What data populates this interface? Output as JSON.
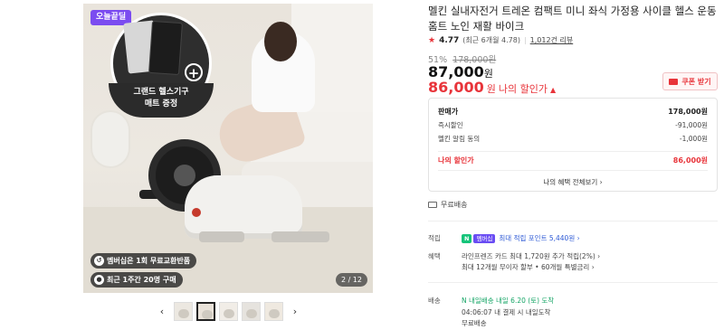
{
  "gallery": {
    "badge_today": "오늘끝딜",
    "gift_label_line1": "그랜드 헬스기구",
    "gift_label_line2": "매트 증정",
    "gift_plus": "+",
    "pill_1": "멤버십은 1회 무료교환반품",
    "pill_2": "최근 1주간 20명 구매",
    "counter": "2 / 12",
    "prev_arrow": "‹",
    "next_arrow": "›"
  },
  "product": {
    "title": "멜킨 실내자전거 트레온 컴팩트 미니 좌식 가정용 사이클 헬스 운동 홈트 노인 재활 바이크",
    "rating": "4.77",
    "rating_note": "(최근 6개월 4.78)",
    "review_count": "1,012건 리뷰",
    "discount_pct": "51%",
    "original_price": "178,000원",
    "price": "87,000",
    "price_unit": "원",
    "my_price": "86,000",
    "my_price_unit": "원",
    "my_price_label": "나의 할인가",
    "coupon_button": "쿠폰 받기"
  },
  "price_breakdown": {
    "rows": [
      {
        "label": "판매가",
        "value": "178,000원"
      },
      {
        "label": "즉시할인",
        "value": "-91,000원"
      },
      {
        "label": "멜킨 알림 동의",
        "value": "-1,000원"
      }
    ],
    "total_label": "나의 할인가",
    "total_value": "86,000원",
    "link": "나의 혜택 전체보기 ›"
  },
  "shipping_summary": "무료배송",
  "benefits": {
    "points_key": "적립",
    "points_badge_n": "N",
    "points_badge_member": "멤버십",
    "points_text": "최대 적립 포인트 5,440원 ›",
    "benefit_key": "혜택",
    "benefit_line1": "라인프렌즈 카드 최대 1,720원 추가 적립(2%) ›",
    "benefit_line2": "최대 12개월 무이자 할부 • 60개월 특별금리 ›",
    "delivery_key": "배송",
    "delivery_badge": "N 내일배송",
    "delivery_date": "내일 6.20 (토) 도착",
    "delivery_time": "04:06:07  내 결제 시 내일도착",
    "delivery_fee": "무료배송"
  },
  "colors": {
    "accent_red": "#e8343a",
    "naver_green": "#16c47a",
    "badge_purple": "#7b4cf0"
  }
}
